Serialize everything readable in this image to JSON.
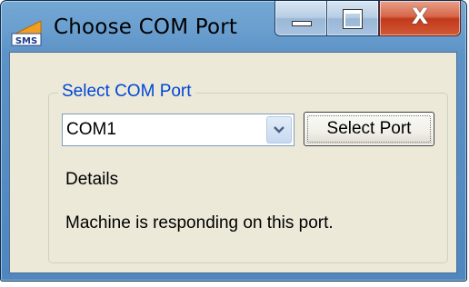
{
  "window": {
    "title": "Choose COM Port",
    "app_icon": "sms-app-icon",
    "app_icon_text": "SMS",
    "caption_buttons": {
      "minimize_icon": "minimize-icon",
      "maximize_icon": "maximize-icon",
      "close_icon": "close-icon",
      "close_glyph": "X"
    }
  },
  "group": {
    "label": "Select COM Port",
    "port_select": {
      "selected_value": "COM1",
      "dropdown_icon": "chevron-down-icon"
    },
    "select_button_label": "Select Port",
    "details_label": "Details",
    "status_text": "Machine is responding on this port."
  },
  "colors": {
    "group_label": "#0046d5",
    "client_background": "#ece9d8",
    "close_button": "#c2391c",
    "title_bar": "#6a9fcf"
  }
}
